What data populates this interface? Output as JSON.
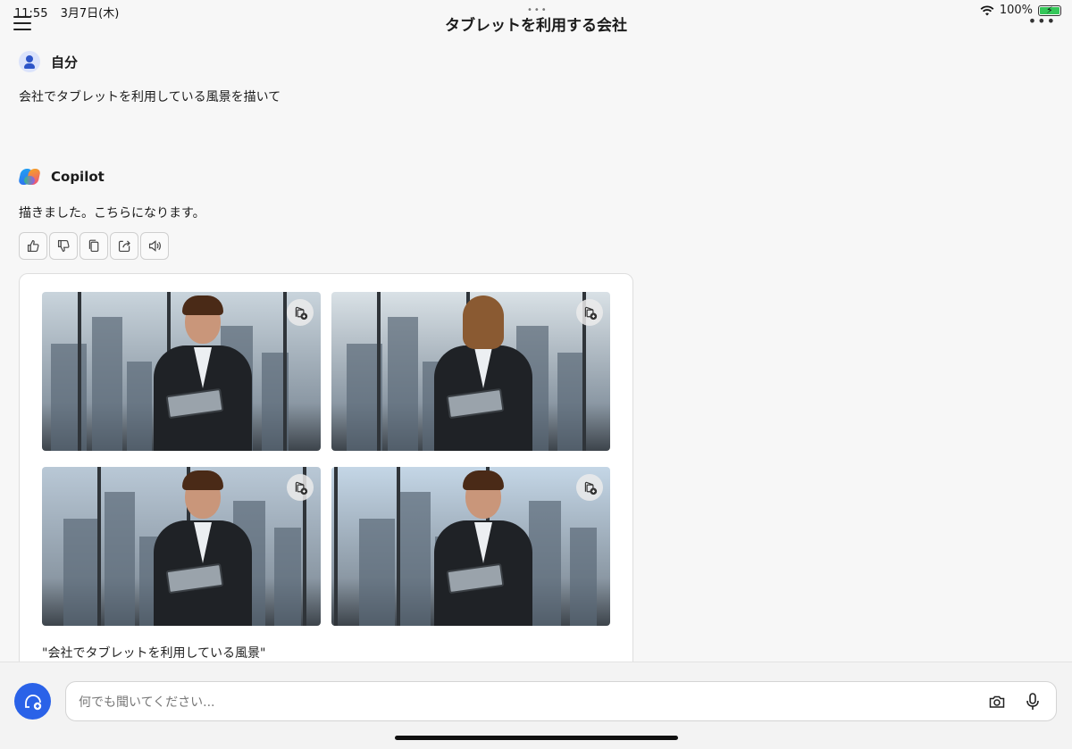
{
  "status": {
    "time": "11:55",
    "date": "3月7日(木)",
    "battery": "100%"
  },
  "header": {
    "title": "タブレットを利用する会社"
  },
  "user": {
    "name": "自分",
    "message": "会社でタブレットを利用している風景を描いて"
  },
  "copilot": {
    "name": "Copilot",
    "message": "描きました。こちらになります。"
  },
  "actions": [
    "thumbs-up-icon",
    "thumbs-down-icon",
    "copy-icon",
    "share-icon",
    "speaker-icon"
  ],
  "images": [
    {
      "subject": "man",
      "sky": "#c9d4dc"
    },
    {
      "subject": "woman",
      "sky": "#d9e1e6"
    },
    {
      "subject": "man",
      "sky": "#b9c8d6"
    },
    {
      "subject": "man",
      "sky": "#c4d6e6"
    }
  ],
  "card": {
    "caption": "\"会社でタブレットを利用している風景\""
  },
  "input": {
    "placeholder": "何でも聞いてください..."
  },
  "colors": {
    "accent": "#2a62e8",
    "background": "#f7f7f7"
  }
}
